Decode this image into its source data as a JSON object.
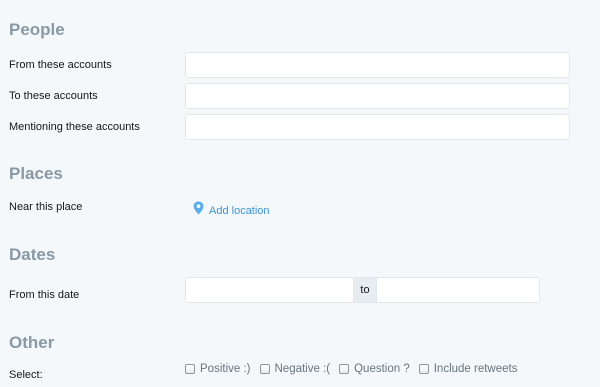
{
  "people": {
    "title": "People",
    "from_label": "From these accounts",
    "to_label": "To these accounts",
    "mentioning_label": "Mentioning these accounts"
  },
  "places": {
    "title": "Places",
    "near_label": "Near this place",
    "add_location": "Add location",
    "icon": "map-pin-icon"
  },
  "dates": {
    "title": "Dates",
    "from_label": "From this date",
    "separator": "to"
  },
  "other": {
    "title": "Other",
    "select_label": "Select:",
    "options": [
      "Positive :)",
      "Negative :(",
      "Question ?",
      "Include retweets"
    ]
  },
  "colors": {
    "background": "#f5f8fa",
    "heading": "#8899a6",
    "link": "#3b94d9",
    "pin": "#55acee",
    "input_border": "#e1e8ed"
  }
}
